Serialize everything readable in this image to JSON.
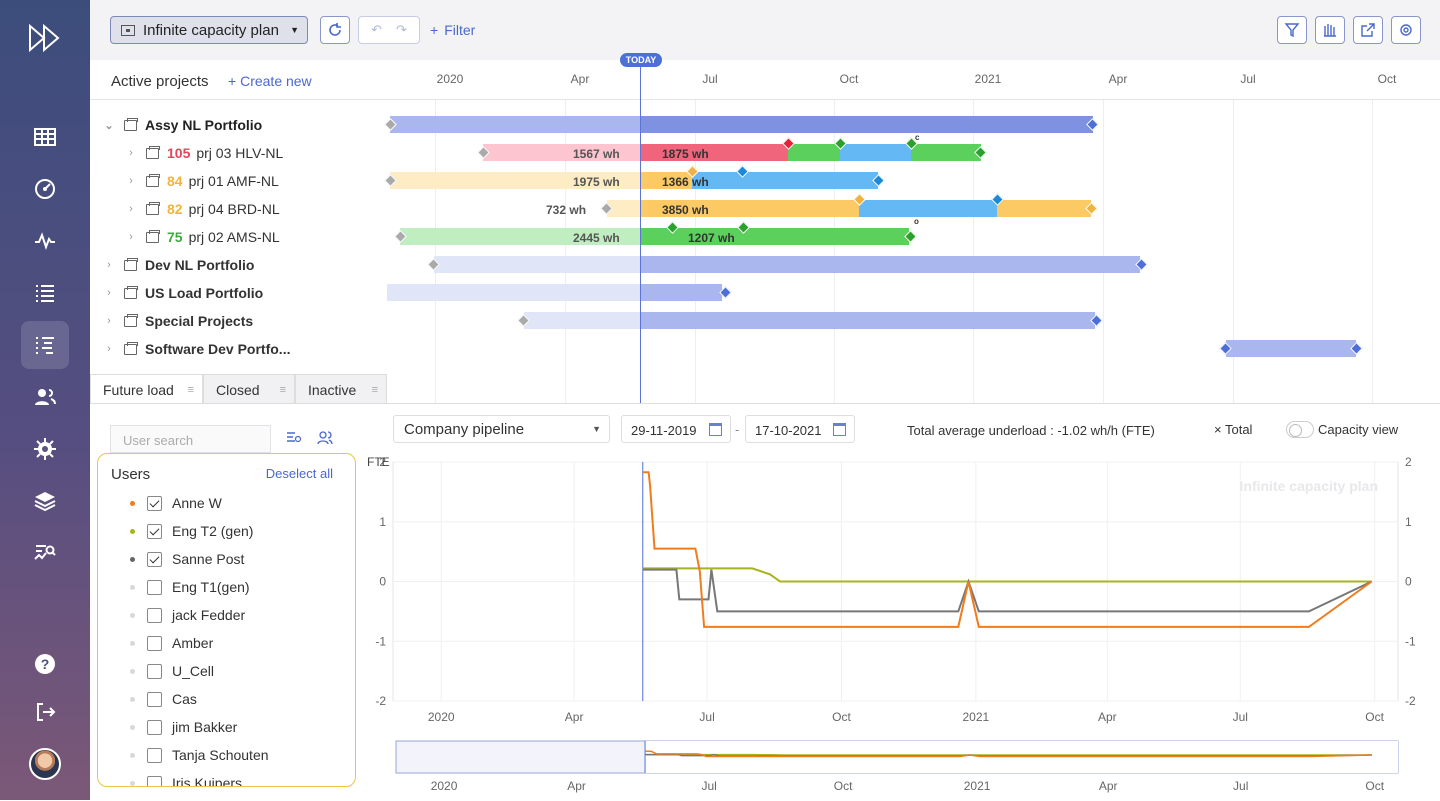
{
  "toolbar": {
    "plan_name": "Infinite capacity plan",
    "filter_label": "Filter"
  },
  "gantt": {
    "title": "Active projects",
    "create_new": "Create new",
    "today_label": "TODAY",
    "timeline_ticks": [
      "2020",
      "Apr",
      "Jul",
      "Oct",
      "2021",
      "Apr",
      "Jul",
      "Oct"
    ],
    "rows": [
      {
        "label": "Assy NL Portfolio",
        "type": "portfolio",
        "expanded": true
      },
      {
        "label": "prj 03 HLV-NL",
        "num": "105",
        "num_color": "#e8435c",
        "type": "project"
      },
      {
        "label": "prj 01 AMF-NL",
        "num": "84",
        "num_color": "#f0b43c",
        "type": "project"
      },
      {
        "label": "prj 04 BRD-NL",
        "num": "82",
        "num_color": "#f0b43c",
        "type": "project"
      },
      {
        "label": "prj 02 AMS-NL",
        "num": "75",
        "num_color": "#3caa3c",
        "type": "project"
      },
      {
        "label": "Dev NL Portfolio",
        "type": "portfolio"
      },
      {
        "label": "US Load Portfolio",
        "type": "portfolio"
      },
      {
        "label": "Special Projects",
        "type": "portfolio"
      },
      {
        "label": "Software Dev Portfo...",
        "type": "portfolio"
      }
    ],
    "bar_labels": {
      "r1_past": "1567 wh",
      "r1_future": "1875 wh",
      "r2_past": "1975 wh",
      "r2_future": "1366 wh",
      "r3_past": "732 wh",
      "r3_future": "3850 wh",
      "r4_past": "2445 wh",
      "r4_future": "1207 wh"
    },
    "marker_c": "c",
    "marker_o": "o"
  },
  "tabs": [
    {
      "label": "Future load",
      "active": true
    },
    {
      "label": "Closed",
      "active": false
    },
    {
      "label": "Inactive",
      "active": false
    }
  ],
  "users": {
    "search_placeholder": "User search",
    "title": "Users",
    "deselect_all": "Deselect all",
    "list": [
      {
        "name": "Anne W",
        "checked": true,
        "color": "#f07c1c"
      },
      {
        "name": "Eng T2 (gen)",
        "checked": true,
        "color": "#a8b41c"
      },
      {
        "name": "Sanne Post",
        "checked": true,
        "color": "#666666"
      },
      {
        "name": "Eng T1(gen)",
        "checked": false,
        "color": "#d8d8d8"
      },
      {
        "name": "jack Fedder",
        "checked": false,
        "color": "#d8d8d8"
      },
      {
        "name": "Amber",
        "checked": false,
        "color": "#d8d8d8"
      },
      {
        "name": "U_Cell",
        "checked": false,
        "color": "#d8d8d8"
      },
      {
        "name": "Cas",
        "checked": false,
        "color": "#d8d8d8"
      },
      {
        "name": "jim Bakker",
        "checked": false,
        "color": "#d8d8d8"
      },
      {
        "name": "Tanja Schouten",
        "checked": false,
        "color": "#d8d8d8"
      },
      {
        "name": "Iris Kuipers",
        "checked": false,
        "color": "#d8d8d8"
      }
    ]
  },
  "controls": {
    "pipeline": "Company pipeline",
    "date_from": "29-11-2019",
    "date_to": "17-10-2021",
    "date_sep": "-",
    "underload": "Total average underload : -1.02 wh/h (FTE)",
    "total_label": "Total",
    "total_icon": "×",
    "capacity_view": "Capacity view"
  },
  "chart_data": {
    "type": "line",
    "watermark": "Infinite capacity plan",
    "ylabel": "FTE",
    "ylim": [
      -2,
      2
    ],
    "yticks": [
      2,
      1,
      0,
      -1,
      -2
    ],
    "x_ticks": [
      "2020",
      "Apr",
      "Jul",
      "Oct",
      "2021",
      "Apr",
      "Jul",
      "Oct"
    ],
    "today": "2020-05-18",
    "series": [
      {
        "name": "Anne W",
        "color": "#f07c1c",
        "points": [
          [
            "2020-05-18",
            1.83
          ],
          [
            "2020-05-22",
            1.83
          ],
          [
            "2020-05-23",
            1.6
          ],
          [
            "2020-05-26",
            0.55
          ],
          [
            "2020-06-23",
            0.55
          ],
          [
            "2020-06-26",
            0.17
          ],
          [
            "2020-06-29",
            -0.76
          ],
          [
            "2020-12-20",
            -0.76
          ],
          [
            "2020-12-27",
            0
          ],
          [
            "2021-01-03",
            -0.76
          ],
          [
            "2021-08-17",
            -0.76
          ],
          [
            "2021-09-29",
            0
          ]
        ]
      },
      {
        "name": "Eng T2 (gen)",
        "color": "#a8b41c",
        "points": [
          [
            "2020-05-18",
            0.22
          ],
          [
            "2020-08-01",
            0.22
          ],
          [
            "2020-08-13",
            0.12
          ],
          [
            "2020-08-20",
            0
          ],
          [
            "2021-09-29",
            0
          ]
        ]
      },
      {
        "name": "Sanne Post",
        "color": "#777777",
        "points": [
          [
            "2020-05-18",
            0.2
          ],
          [
            "2020-06-10",
            0.2
          ],
          [
            "2020-06-12",
            -0.3
          ],
          [
            "2020-07-02",
            -0.3
          ],
          [
            "2020-07-04",
            0.2
          ],
          [
            "2020-07-08",
            -0.5
          ],
          [
            "2020-12-20",
            -0.5
          ],
          [
            "2020-12-27",
            0
          ],
          [
            "2021-01-03",
            -0.5
          ],
          [
            "2021-08-17",
            -0.5
          ],
          [
            "2021-09-29",
            0
          ]
        ]
      }
    ]
  },
  "navigator": {
    "x_ticks": [
      "2020",
      "Apr",
      "Jul",
      "Oct",
      "2021",
      "Apr",
      "Jul",
      "Oct"
    ]
  }
}
